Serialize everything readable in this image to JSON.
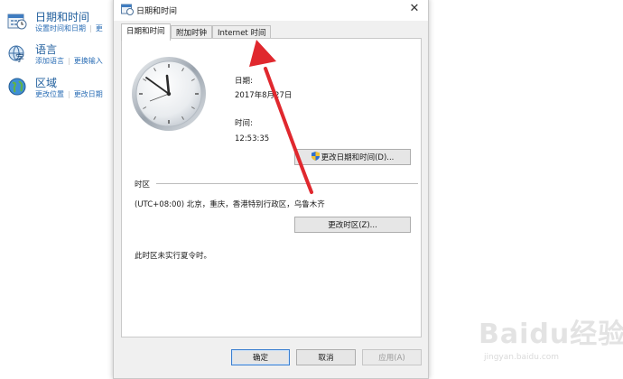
{
  "control_panel": {
    "items": [
      {
        "title": "日期和时间",
        "links": [
          "设置时间和日期",
          "更"
        ],
        "icon": "clock-calendar-icon"
      },
      {
        "title": "语言",
        "links": [
          "添加语言",
          "更换输入"
        ],
        "icon": "language-icon"
      },
      {
        "title": "区域",
        "links": [
          "更改位置",
          "更改日期"
        ],
        "icon": "globe-icon"
      }
    ]
  },
  "dialog": {
    "title": "日期和时间",
    "close_glyph": "✕",
    "tabs": [
      {
        "label": "日期和时间",
        "active": true
      },
      {
        "label": "附加时钟",
        "active": false
      },
      {
        "label": "Internet 时间",
        "active": false
      }
    ],
    "date_label": "日期:",
    "date_value": "2017年8月27日",
    "time_label": "时间:",
    "time_value": "12:53:35",
    "change_datetime_button": "更改日期和时间(D)...",
    "timezone_header": "时区",
    "timezone_value": "(UTC+08:00) 北京，重庆，香港特别行政区，乌鲁木齐",
    "change_timezone_button": "更改时区(Z)...",
    "dst_note": "此时区未实行夏令时。",
    "ok_button": "确定",
    "cancel_button": "取消",
    "apply_button": "应用(A)"
  },
  "watermark": {
    "brand": "Baidu经验",
    "url": "jingyan.baidu.com"
  },
  "colors": {
    "link": "#2a6db5",
    "title_link": "#1e5d9c",
    "arrow": "#e0282e",
    "dialog_bg": "#f0f0f0"
  }
}
